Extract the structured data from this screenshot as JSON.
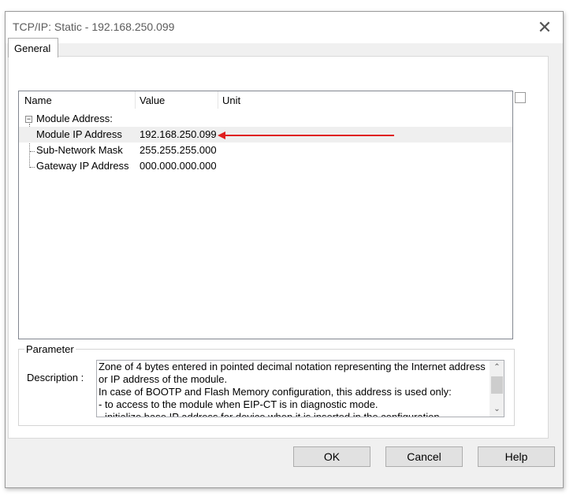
{
  "window": {
    "title": "TCP/IP: Static - 192.168.250.099",
    "close_icon": "close-icon"
  },
  "tabs": [
    {
      "label": "General"
    }
  ],
  "grid": {
    "columns": [
      "Name",
      "Value",
      "Unit"
    ],
    "group": {
      "label": "Module Address:",
      "expander": "−"
    },
    "rows": [
      {
        "name": "Module IP Address",
        "value": "192.168.250.099",
        "unit": ""
      },
      {
        "name": "Sub-Network Mask",
        "value": "255.255.255.000",
        "unit": ""
      },
      {
        "name": "Gateway IP Address",
        "value": "000.000.000.000",
        "unit": ""
      }
    ]
  },
  "annotation": {
    "color": "#e02020",
    "icon": "red-arrow-icon"
  },
  "parameter": {
    "legend": "Parameter",
    "description_label": "Description :",
    "description": "Zone of 4 bytes entered in pointed decimal notation representing the Internet address or IP address of the module.\nIn case of BOOTP and Flash Memory configuration, this address is used only:\n- to access to the module when EIP-CT is in diagnostic mode.\n- initialize base IP address for device when it is inserted in the configuration."
  },
  "buttons": {
    "ok": "OK",
    "cancel": "Cancel",
    "help": "Help"
  },
  "scrollbar": {
    "up": "⌃",
    "down": "⌄"
  }
}
